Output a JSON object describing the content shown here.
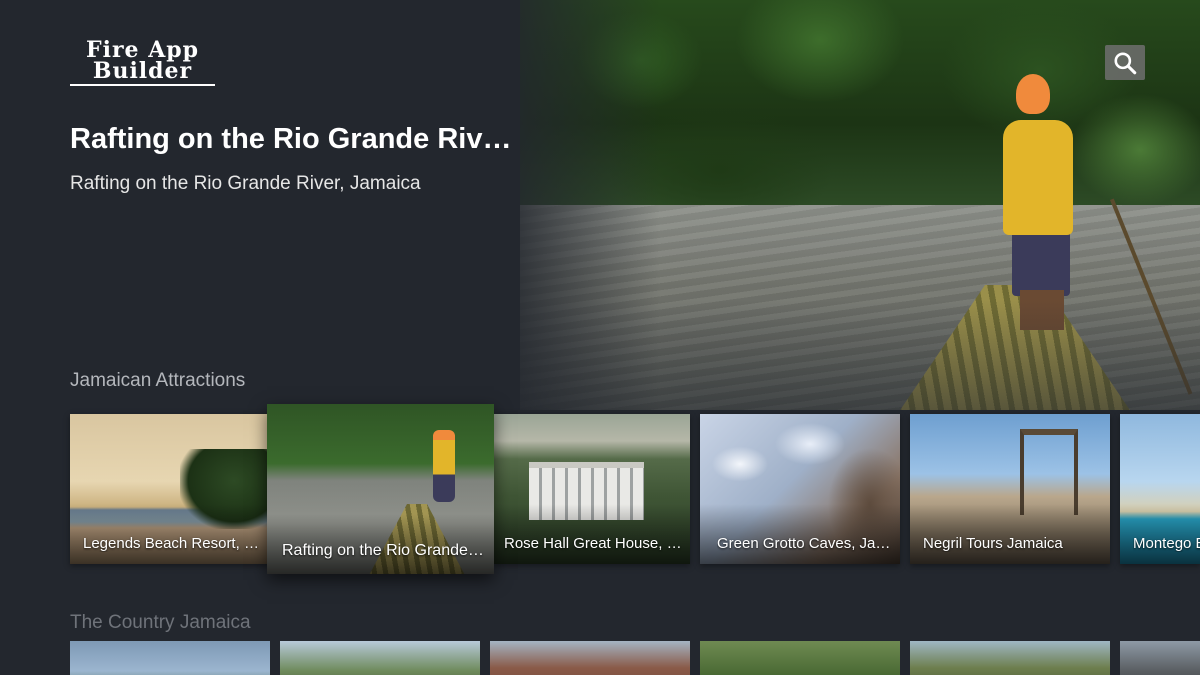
{
  "app": {
    "logo_line1": "Fire App",
    "logo_line2": "Builder"
  },
  "search": {
    "icon": "search-icon"
  },
  "featured": {
    "title": "Rafting on the Rio Grande River, Jamaica",
    "subtitle": "Rafting on the Rio Grande River, Jamaica"
  },
  "rows": [
    {
      "header": "Jamaican Attractions",
      "items": [
        {
          "label": "Legends Beach Resort, Negril"
        },
        {
          "label": "Rafting on the Rio Grande River, Jamaica"
        },
        {
          "label": "Rose Hall Great House, Montego Bay"
        },
        {
          "label": "Green Grotto Caves, Jamaica"
        },
        {
          "label": "Negril Tours Jamaica"
        },
        {
          "label": "Montego Bay"
        }
      ]
    },
    {
      "header": "The Country Jamaica"
    }
  ],
  "colors": {
    "background": "#23272e",
    "row_header": "#b4b7bc",
    "row_header_dim": "#6f737a"
  }
}
